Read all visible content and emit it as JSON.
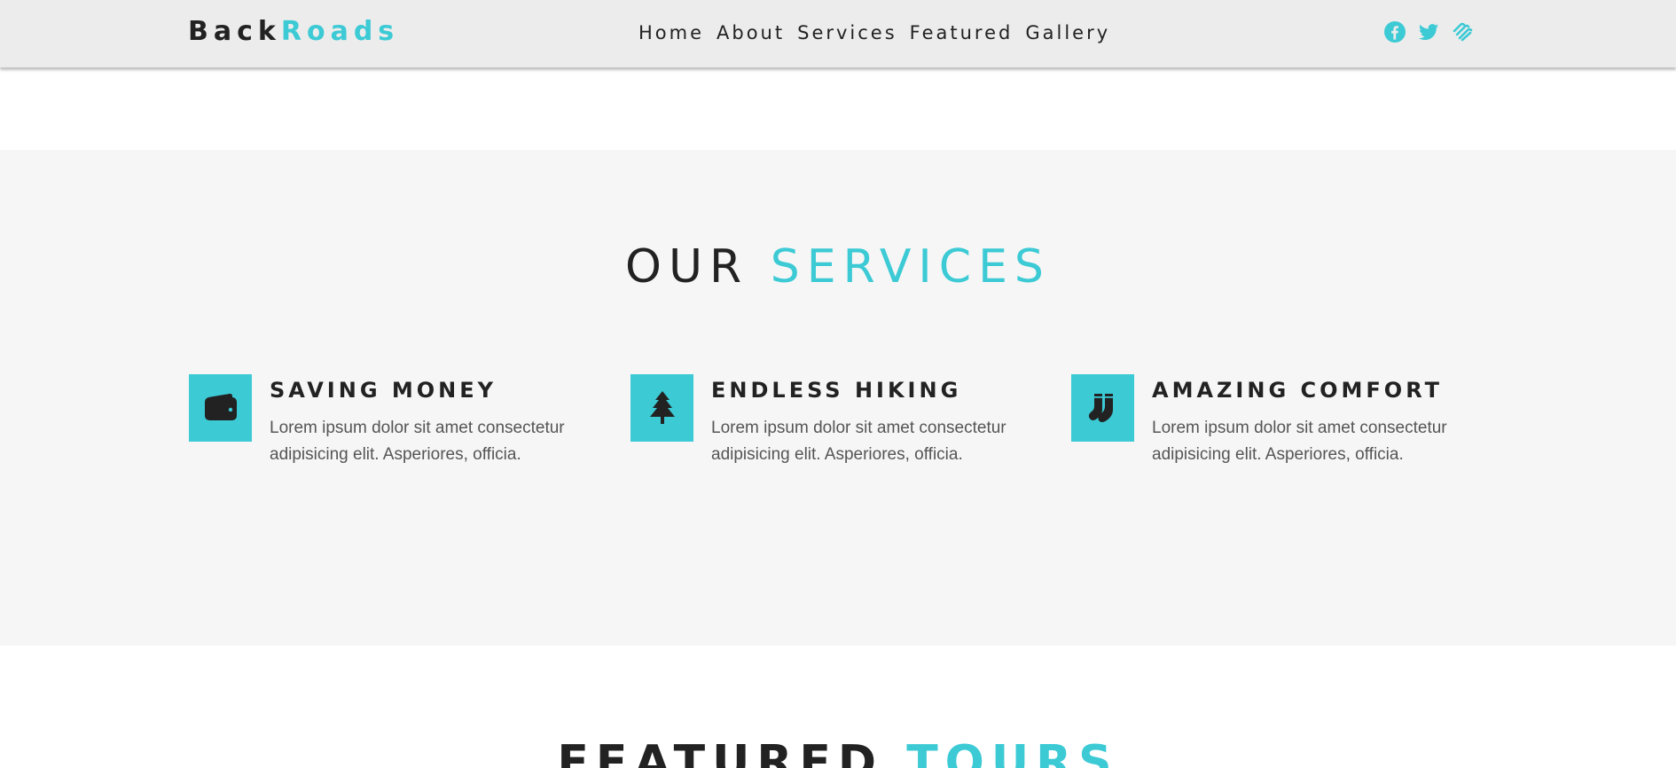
{
  "navbar": {
    "logo": {
      "part1": "Back",
      "part2": "Roads"
    },
    "links": [
      "Home",
      "About",
      "Services",
      "Featured",
      "Gallery"
    ],
    "social_icons": [
      "facebook-icon",
      "twitter-icon",
      "squarespace-icon"
    ]
  },
  "services": {
    "title": {
      "part1": "OUR",
      "part2": "SERVICES"
    },
    "items": [
      {
        "icon": "wallet-icon",
        "title": "SAVING MONEY",
        "text": "Lorem ipsum dolor sit amet consectetur adipisicing elit. Asperiores, officia."
      },
      {
        "icon": "tree-icon",
        "title": "ENDLESS HIKING",
        "text": "Lorem ipsum dolor sit amet consectetur adipisicing elit. Asperiores, officia."
      },
      {
        "icon": "socks-icon",
        "title": "AMAZING COMFORT",
        "text": "Lorem ipsum dolor sit amet consectetur adipisicing elit. Asperiores, officia."
      }
    ]
  },
  "featured": {
    "title": {
      "part1": "FEATURED",
      "part2": "TOURS"
    }
  },
  "colors": {
    "accent": "#3ccad5",
    "dark": "#222222",
    "navbar_bg": "#ececec",
    "section_bg": "#f6f6f6"
  }
}
